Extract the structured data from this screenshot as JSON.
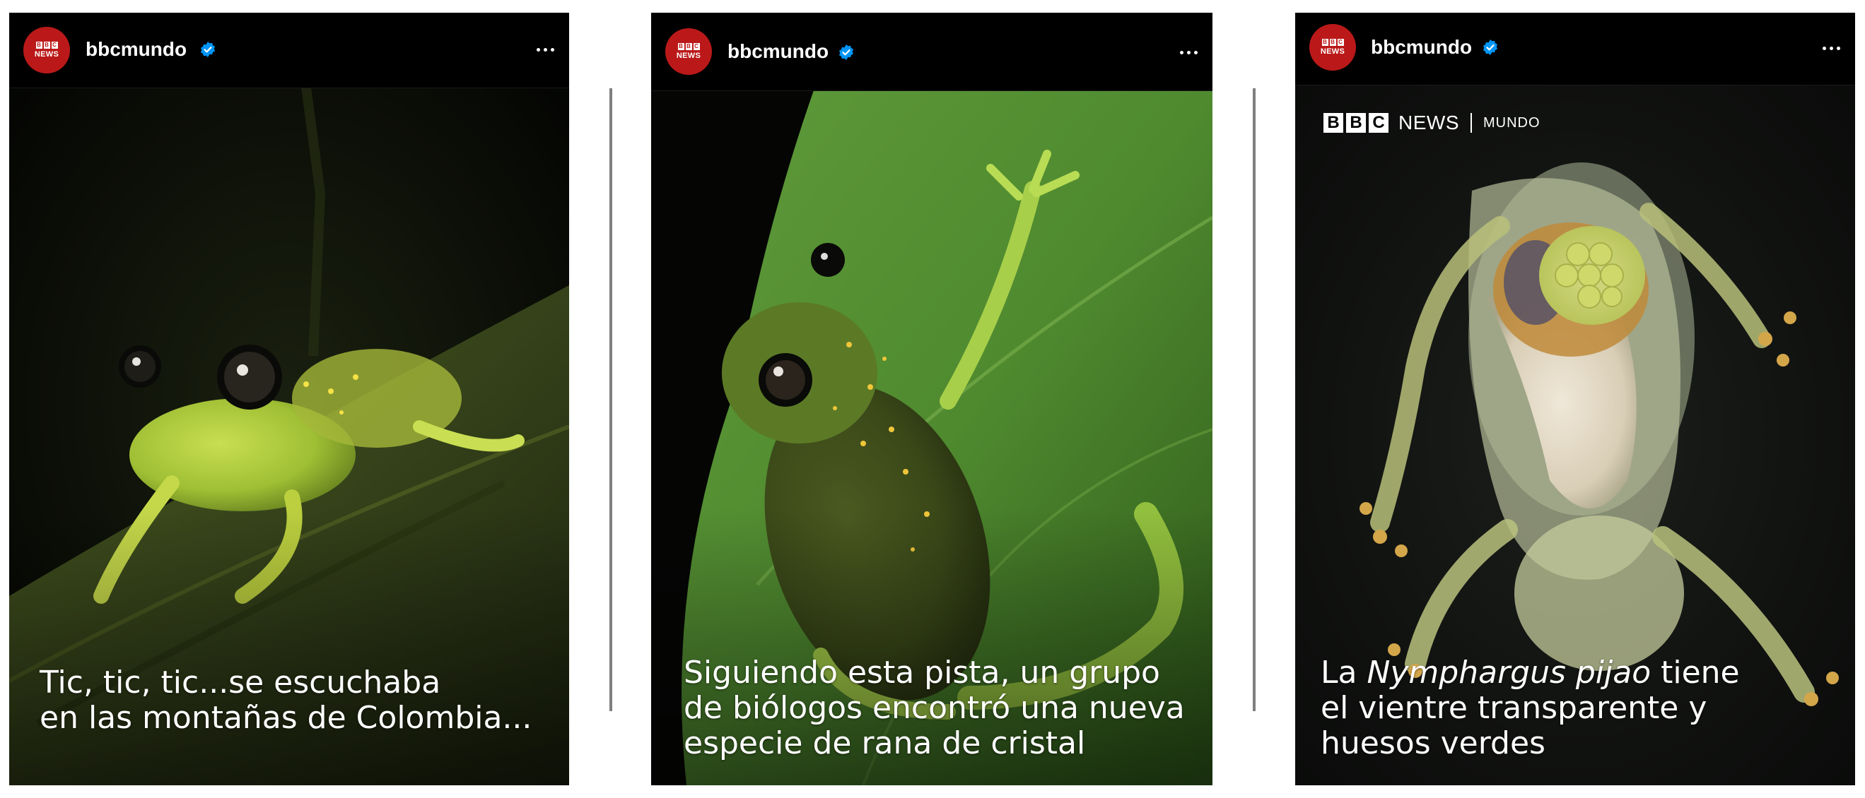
{
  "posts": [
    {
      "username": "bbcmundo",
      "avatar_label": "NEWS",
      "avatar_blocks": [
        "B",
        "B",
        "C"
      ],
      "caption_lines": [
        "Tic, tic, tic...se escuchaba",
        "en las montañas de Colombia..."
      ]
    },
    {
      "username": "bbcmundo",
      "avatar_label": "NEWS",
      "avatar_blocks": [
        "B",
        "B",
        "C"
      ],
      "caption_lines": [
        "Siguiendo esta pista, un grupo",
        "de biólogos encontró una nueva",
        "especie de rana de cristal"
      ]
    },
    {
      "username": "bbcmundo",
      "avatar_label": "NEWS",
      "avatar_blocks": [
        "B",
        "B",
        "C"
      ],
      "caption_prefix": "La ",
      "caption_italic": "Nymphargus pijao",
      "caption_suffix": " tiene",
      "caption_lines": [
        "el vientre transparente y",
        "huesos verdes"
      ],
      "logo": {
        "blocks": [
          "B",
          "B",
          "C"
        ],
        "news": "NEWS",
        "mundo": "MUNDO"
      }
    }
  ],
  "icons": {
    "verified": "verified-badge-icon",
    "more": "more-options-icon"
  },
  "colors": {
    "brand_red": "#bb1919",
    "verified_blue": "#0095f6",
    "header_bg": "#000000"
  }
}
